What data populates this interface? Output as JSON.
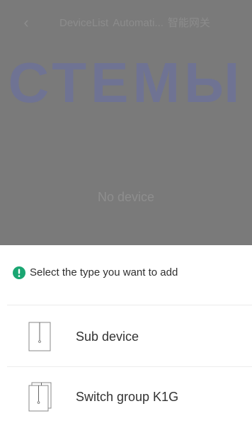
{
  "navbar": {
    "back_icon": "back-chevron-icon",
    "tabs": [
      "DeviceList",
      "Automati...",
      "智能网关"
    ]
  },
  "watermark": {
    "text": "СТЕМЫ",
    "color": "#5a67a6"
  },
  "main": {
    "empty_text": "No device"
  },
  "sheet": {
    "header": {
      "icon": "info-icon",
      "icon_color": "#1aa672",
      "text": "Select the type you want to add"
    },
    "options": [
      {
        "icon": "switch-panel-icon",
        "label": "Sub device"
      },
      {
        "icon": "switch-group-icon",
        "label": "Switch group K1G"
      }
    ]
  }
}
